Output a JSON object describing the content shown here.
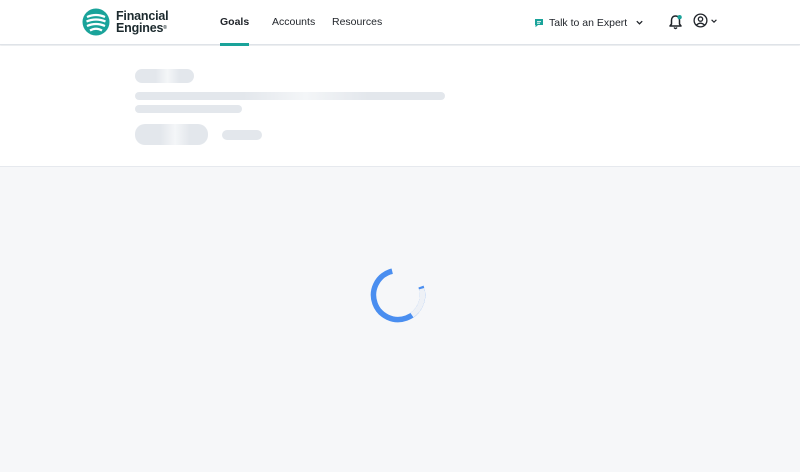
{
  "app": {
    "brand_line1": "Financial",
    "brand_line2": "Engines",
    "brand_mark": "®",
    "accent_color": "#1aa39a",
    "spinner_color": "#4a8ef0"
  },
  "nav": {
    "items": [
      {
        "label": "Goals",
        "active": true
      },
      {
        "label": "Accounts",
        "active": false
      },
      {
        "label": "Resources",
        "active": false
      }
    ]
  },
  "header_actions": {
    "expert_label": "Talk to an Expert",
    "expert_icon": "chat-icon",
    "notifications_icon": "bell-icon",
    "account_icon": "user-circle-icon"
  },
  "page_state": {
    "loading": true
  }
}
